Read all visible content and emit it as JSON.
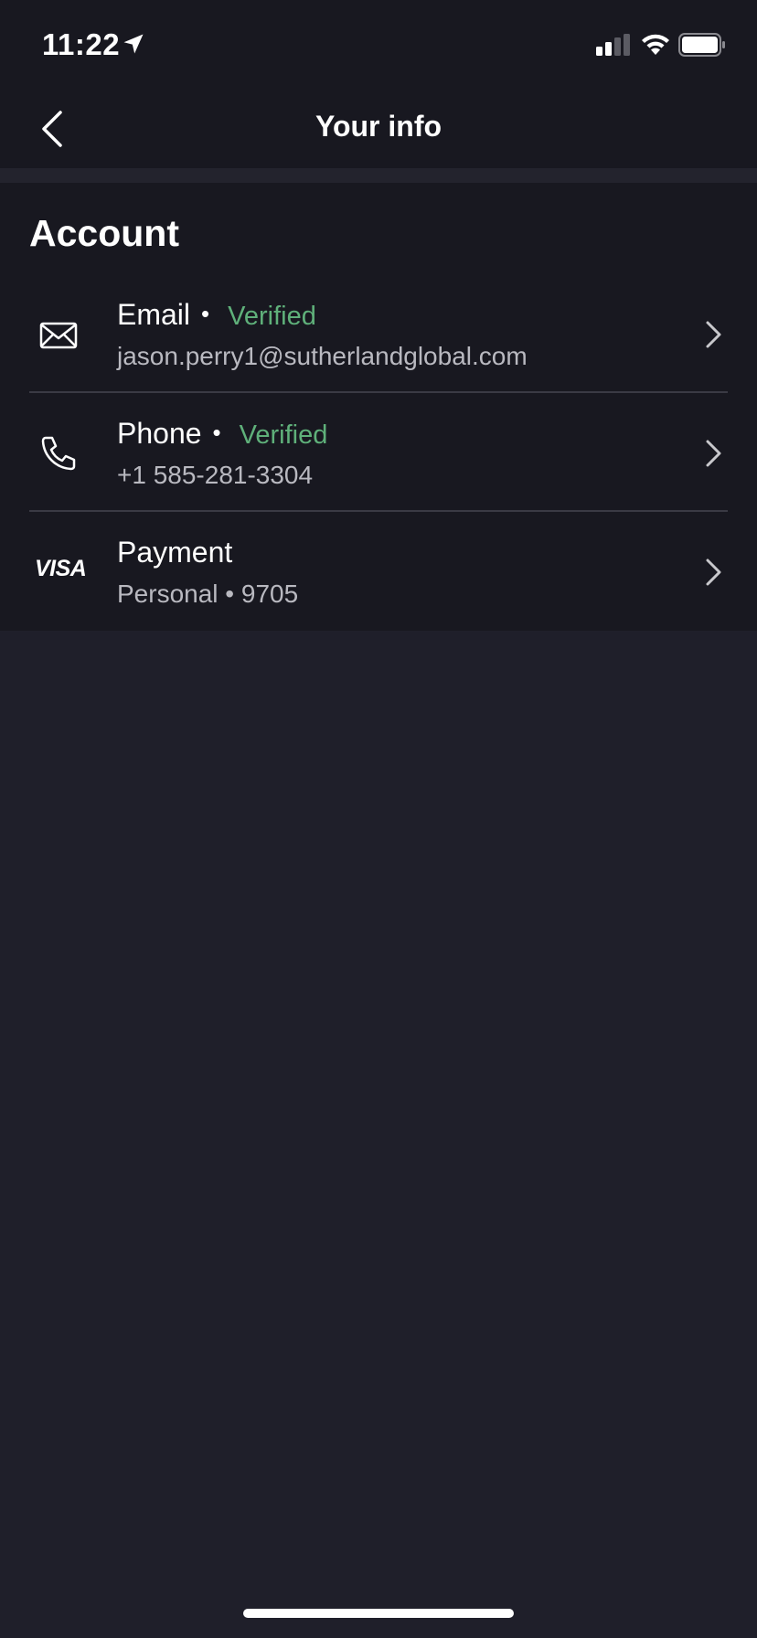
{
  "status_bar": {
    "time": "11:22",
    "icons": [
      "location-arrow-icon",
      "signal-icon",
      "wifi-icon",
      "battery-icon"
    ]
  },
  "nav": {
    "title": "Your info",
    "back_icon": "chevron-left-icon"
  },
  "account": {
    "section_title": "Account",
    "rows": [
      {
        "icon": "envelope-icon",
        "title": "Email",
        "dot": "•",
        "badge": "Verified",
        "subtitle": "jason.perry1@sutherlandglobal.com"
      },
      {
        "icon": "phone-icon",
        "title": "Phone",
        "dot": "•",
        "badge": "Verified",
        "subtitle": "+1 585-281-3304"
      },
      {
        "icon": "visa-icon",
        "icon_text": "VISA",
        "title": "Payment",
        "subtitle": "Personal • 9705"
      }
    ]
  },
  "colors": {
    "background": "#1f1f2a",
    "panel": "#181820",
    "verified": "#5fb07a",
    "subtitle": "#b9b9c0"
  }
}
